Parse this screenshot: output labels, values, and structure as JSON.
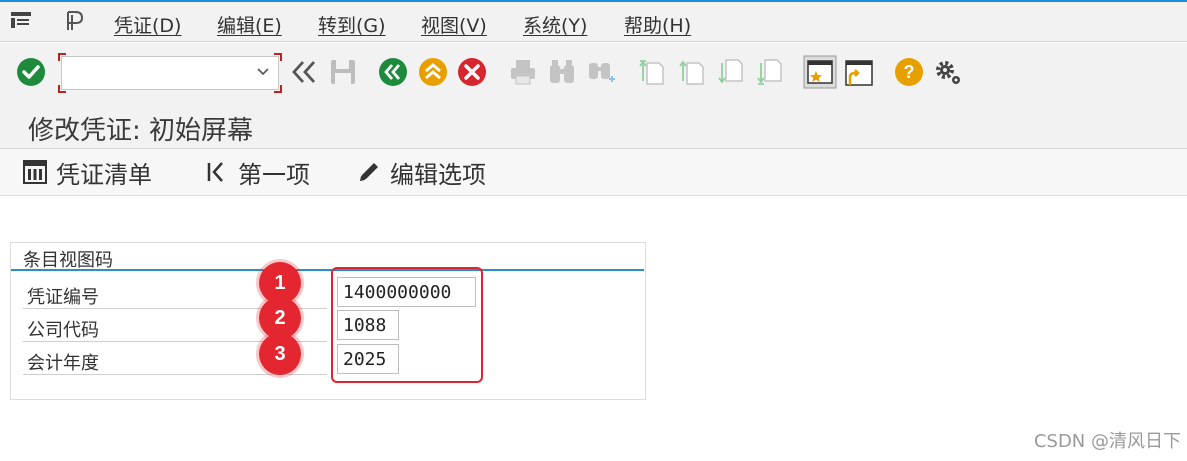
{
  "menubar": {
    "items": [
      {
        "label": "凭证(D)"
      },
      {
        "label": "编辑(E)"
      },
      {
        "label": "转到(G)"
      },
      {
        "label": "视图(V)"
      },
      {
        "label": "系统(Y)"
      },
      {
        "label": "帮助(H)"
      }
    ]
  },
  "toolbar": {
    "command_value": "",
    "icons": [
      "enter-icon",
      "back-double-icon",
      "save-icon",
      "back-icon",
      "exit-icon",
      "cancel-icon",
      "print-icon",
      "find-icon",
      "find-next-icon",
      "first-page-icon",
      "previous-page-icon",
      "next-page-icon",
      "last-page-icon",
      "create-session-icon",
      "shortcut-icon",
      "help-icon",
      "settings-icon"
    ]
  },
  "title": "修改凭证: 初始屏幕",
  "app_toolbar": {
    "document_list": "凭证清单",
    "first_item": "第一项",
    "editing_options": "编辑选项"
  },
  "group": {
    "title": "条目视图码",
    "fields": [
      {
        "label": "凭证编号",
        "value": "1400000000",
        "badge": "1"
      },
      {
        "label": "公司代码",
        "value": "1088",
        "badge": "2"
      },
      {
        "label": "会计年度",
        "value": "2025",
        "badge": "3"
      }
    ]
  },
  "watermark": "CSDN @清风日下",
  "colors": {
    "accent_blue": "#1a8fd8",
    "annotation_red": "#e0242f",
    "ok_green": "#1e8a3c",
    "warn_yellow": "#e8a000",
    "cancel_red": "#d8262f"
  }
}
